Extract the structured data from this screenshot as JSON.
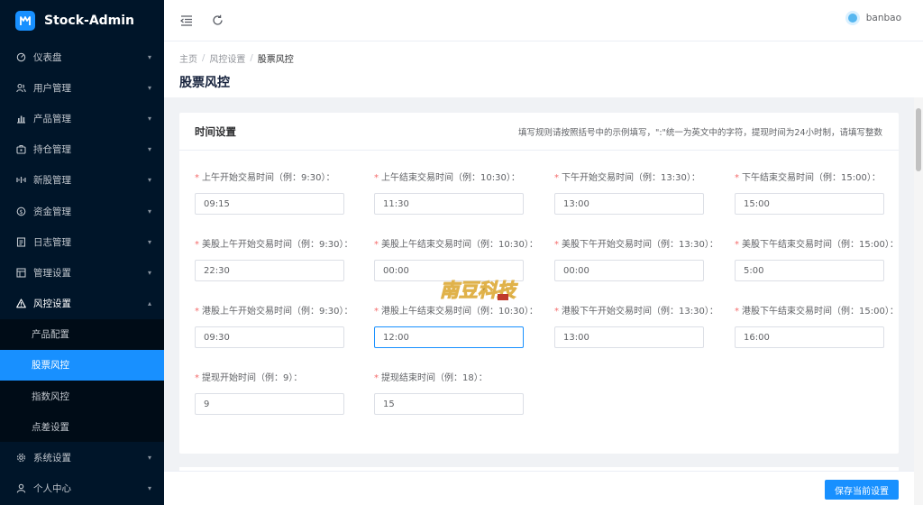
{
  "app": {
    "title": "Stock-Admin"
  },
  "sidebar": {
    "items": [
      {
        "label": "仪表盘",
        "icon": "dashboard-icon"
      },
      {
        "label": "用户管理",
        "icon": "users-icon"
      },
      {
        "label": "产品管理",
        "icon": "chart-bar-icon"
      },
      {
        "label": "持仓管理",
        "icon": "briefcase-icon"
      },
      {
        "label": "新股管理",
        "icon": "ipo-icon"
      },
      {
        "label": "资金管理",
        "icon": "coin-icon"
      },
      {
        "label": "日志管理",
        "icon": "log-icon"
      },
      {
        "label": "管理设置",
        "icon": "admin-settings-icon"
      },
      {
        "label": "风控设置",
        "icon": "warning-icon"
      }
    ],
    "submenu": [
      {
        "label": "产品配置"
      },
      {
        "label": "股票风控"
      },
      {
        "label": "指数风控"
      },
      {
        "label": "点差设置"
      }
    ],
    "bottom_items": [
      {
        "label": "系统设置",
        "icon": "gear-icon"
      },
      {
        "label": "个人中心",
        "icon": "user-icon"
      }
    ]
  },
  "header": {
    "user_name": "banbao"
  },
  "breadcrumb": {
    "home": "主页",
    "parent": "风控设置",
    "current": "股票风控"
  },
  "page": {
    "title": "股票风控"
  },
  "card": {
    "title": "时间设置",
    "tip": "填写规则请按照括号中的示例填写，\":\"统一为英文中的字符，提现时间为24小时制，请填写整数"
  },
  "fields": [
    {
      "label": "上午开始交易时间（例：9:30）：",
      "value": "09:15"
    },
    {
      "label": "上午结束交易时间（例：10:30）：",
      "value": "11:30"
    },
    {
      "label": "下午开始交易时间（例：13:30）：",
      "value": "13:00"
    },
    {
      "label": "下午结束交易时间（例：15:00）：",
      "value": "15:00"
    },
    {
      "label": "美股上午开始交易时间（例：9:30）：",
      "value": "22:30"
    },
    {
      "label": "美股上午结束交易时间（例：10:30）：",
      "value": "00:00"
    },
    {
      "label": "美股下午开始交易时间（例：13:30）：",
      "value": "00:00"
    },
    {
      "label": "美股下午结束交易时间（例：15:00）：",
      "value": "5:00"
    },
    {
      "label": "港股上午开始交易时间（例：9:30）：",
      "value": "09:30"
    },
    {
      "label": "港股上午结束交易时间（例：10:30）：",
      "value": "12:00"
    },
    {
      "label": "港股下午开始交易时间（例：13:30）：",
      "value": "13:00"
    },
    {
      "label": "港股下午结束交易时间（例：15:00）：",
      "value": "16:00"
    },
    {
      "label": "提现开始时间（例：9）：",
      "value": "9"
    },
    {
      "label": "提现结束时间（例：18）：",
      "value": "15"
    }
  ],
  "footer": {
    "save_label": "保存当前设置"
  },
  "watermark": {
    "text": "南豆科技"
  },
  "colors": {
    "primary": "#1890ff",
    "sidebar_bg": "#001529",
    "submenu_bg": "#000c17",
    "required": "#f56c6c"
  }
}
